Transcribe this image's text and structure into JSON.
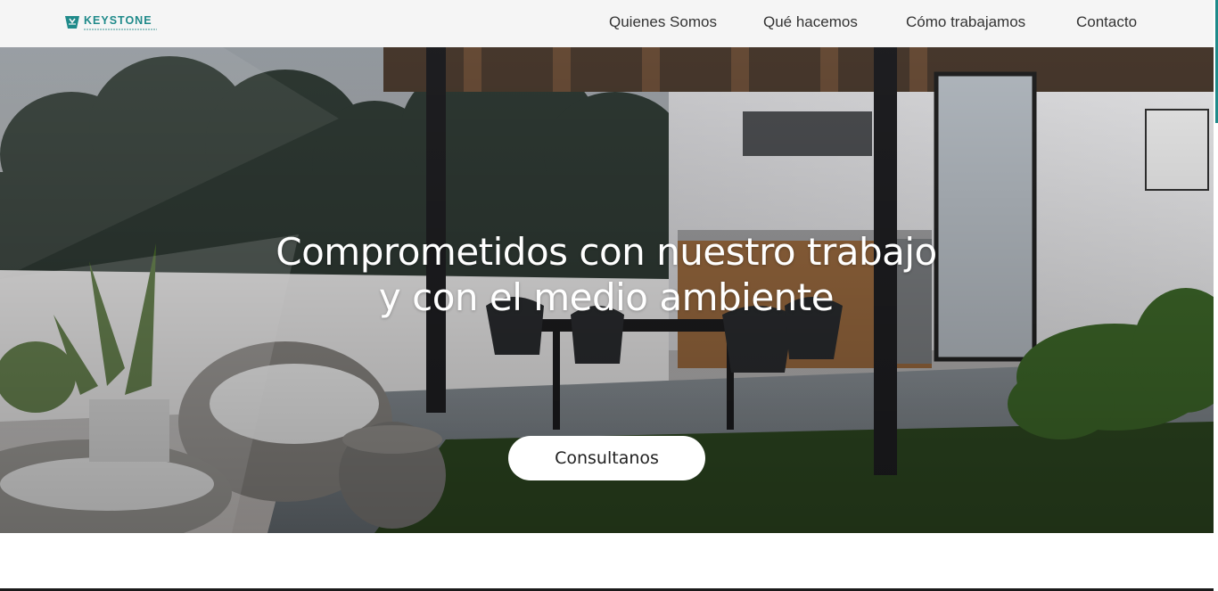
{
  "brand": {
    "name": "KEYSTONE",
    "accent_color": "#1f8a8a"
  },
  "nav": {
    "items": [
      {
        "label": "Quienes Somos"
      },
      {
        "label": "Qué hacemos"
      },
      {
        "label": "Cómo trabajamos"
      },
      {
        "label": "Contacto"
      }
    ]
  },
  "hero": {
    "title": "Comprometidos con nuestro trabajo y con el medio ambiente",
    "cta_label": "Consultanos"
  }
}
